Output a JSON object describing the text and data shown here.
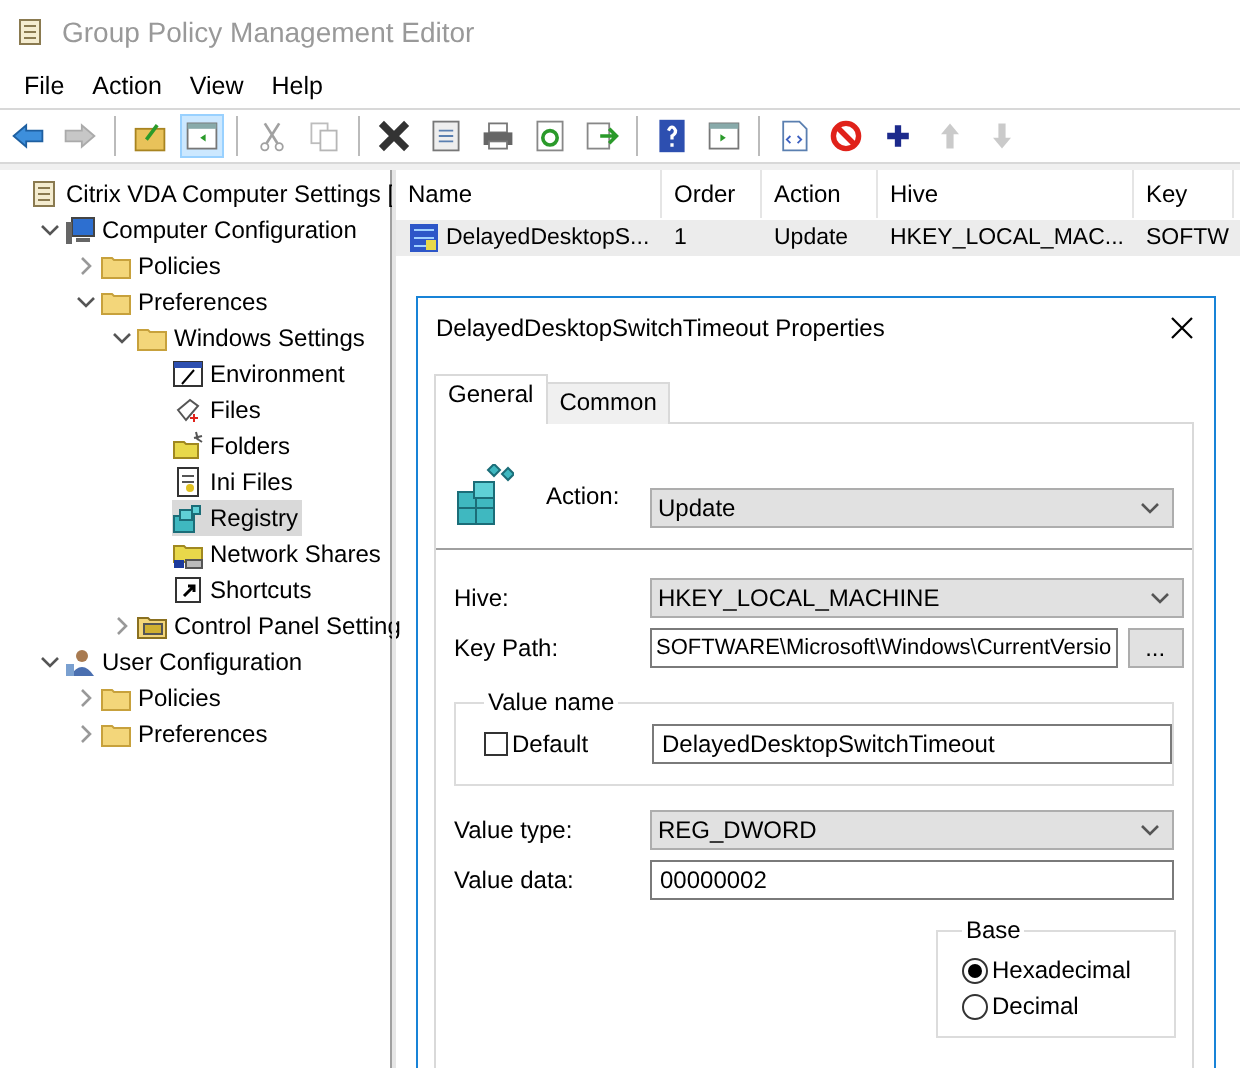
{
  "window": {
    "title": "Group Policy Management Editor"
  },
  "menu": [
    "File",
    "Action",
    "View",
    "Help"
  ],
  "toolbar": [
    [
      {
        "kind": "back",
        "disabled": false,
        "on": false
      },
      {
        "kind": "forward",
        "disabled": true,
        "on": false
      }
    ],
    [
      {
        "kind": "up-folder",
        "disabled": false,
        "on": false
      },
      {
        "kind": "pane",
        "disabled": false,
        "on": true
      }
    ],
    [
      {
        "kind": "cut",
        "disabled": true,
        "on": false
      },
      {
        "kind": "copy",
        "disabled": true,
        "on": false
      }
    ],
    [
      {
        "kind": "delete",
        "disabled": false,
        "on": false
      },
      {
        "kind": "properties",
        "disabled": false,
        "on": false
      },
      {
        "kind": "print",
        "disabled": false,
        "on": false
      },
      {
        "kind": "refresh",
        "disabled": false,
        "on": false
      },
      {
        "kind": "export",
        "disabled": false,
        "on": false
      }
    ],
    [
      {
        "kind": "help",
        "disabled": false,
        "on": false
      },
      {
        "kind": "pane-right",
        "disabled": false,
        "on": false
      }
    ],
    [
      {
        "kind": "xml",
        "disabled": false,
        "on": false
      },
      {
        "kind": "stop",
        "disabled": false,
        "on": false
      },
      {
        "kind": "add",
        "disabled": false,
        "on": false
      },
      {
        "kind": "move-up",
        "disabled": true,
        "on": false
      },
      {
        "kind": "move-down",
        "disabled": true,
        "on": false
      }
    ]
  ],
  "tree": [
    {
      "label": "Citrix VDA Computer Settings [",
      "kind": "scroll",
      "selected": false,
      "children": [
        {
          "label": "Computer Configuration",
          "kind": "computer",
          "selected": false,
          "expanded": true,
          "children": [
            {
              "label": "Policies",
              "kind": "folder",
              "selected": false,
              "expanded": false
            },
            {
              "label": "Preferences",
              "kind": "folder",
              "selected": false,
              "expanded": true,
              "children": [
                {
                  "label": "Windows Settings",
                  "kind": "folder",
                  "selected": false,
                  "expanded": true,
                  "children": [
                    {
                      "label": "Environment",
                      "kind": "environment",
                      "selected": false
                    },
                    {
                      "label": "Files",
                      "kind": "files",
                      "selected": false
                    },
                    {
                      "label": "Folders",
                      "kind": "folders",
                      "selected": false
                    },
                    {
                      "label": "Ini Files",
                      "kind": "ini",
                      "selected": false
                    },
                    {
                      "label": "Registry",
                      "kind": "registry",
                      "selected": true
                    },
                    {
                      "label": "Network Shares",
                      "kind": "shares",
                      "selected": false
                    },
                    {
                      "label": "Shortcuts",
                      "kind": "shortcut",
                      "selected": false
                    }
                  ]
                },
                {
                  "label": "Control Panel Setting",
                  "kind": "control",
                  "selected": false,
                  "expanded": false
                }
              ]
            }
          ]
        },
        {
          "label": "User Configuration",
          "kind": "user",
          "selected": false,
          "expanded": true,
          "children": [
            {
              "label": "Policies",
              "kind": "folder",
              "selected": false,
              "expanded": false
            },
            {
              "label": "Preferences",
              "kind": "folder",
              "selected": false,
              "expanded": false
            }
          ]
        }
      ]
    }
  ],
  "table": {
    "columns": [
      "Name",
      "Order",
      "Action",
      "Hive",
      "Key"
    ],
    "rows": [
      {
        "selected": true,
        "cells": [
          "DelayedDesktopS...",
          "1",
          "Update",
          "HKEY_LOCAL_MAC...",
          "SOFTW"
        ]
      }
    ]
  },
  "dialog": {
    "title": "DelayedDesktopSwitchTimeout Properties",
    "tabs": [
      {
        "label": "General",
        "selected": true
      },
      {
        "label": "Common",
        "selected": false
      }
    ],
    "action": {
      "label": "Action:",
      "value": "Update"
    },
    "hive": {
      "label": "Hive:",
      "value": "HKEY_LOCAL_MACHINE"
    },
    "key_path": {
      "label": "Key Path:",
      "value": "SOFTWARE\\Microsoft\\Windows\\CurrentVersio",
      "browse": "..."
    },
    "value_name": {
      "title": "Value name",
      "default_label": "Default",
      "default_checked": false,
      "value": "DelayedDesktopSwitchTimeout"
    },
    "value_type": {
      "label": "Value type:",
      "value": "REG_DWORD"
    },
    "value_data": {
      "label": "Value data:",
      "value": "00000002"
    },
    "base": {
      "title": "Base",
      "options": [
        {
          "label": "Hexadecimal",
          "selected": true
        },
        {
          "label": "Decimal",
          "selected": false
        }
      ]
    }
  }
}
